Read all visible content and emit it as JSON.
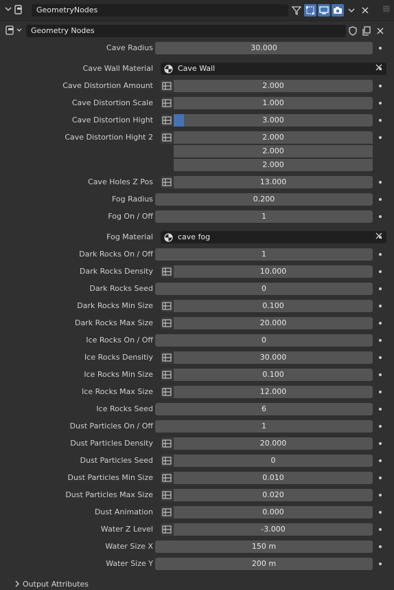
{
  "header": {
    "modifier_name": "GeometryNodes",
    "node_group_name": "Geometry Nodes"
  },
  "inputs": [
    {
      "label": "Cave Radius",
      "value": "30.000"
    },
    {
      "label": "Cave Wall Material",
      "value": "Cave Wall"
    },
    {
      "label": "Cave Distortion Amount",
      "value": "2.000"
    },
    {
      "label": "Cave Distortion Scale",
      "value": "1.000"
    },
    {
      "label": "Cave Distortion Hight",
      "value": "3.000",
      "fill": 0.05
    },
    {
      "label": "Cave Distortion Hight 2",
      "values": [
        "2.000",
        "2.000",
        "2.000"
      ]
    },
    {
      "label": "Cave Holes Z Pos",
      "value": "13.000"
    },
    {
      "label": "Fog Radius",
      "value": "0.200"
    },
    {
      "label": "Fog On / Off",
      "value": "1"
    },
    {
      "label": "Fog Material",
      "value": "cave fog"
    },
    {
      "label": "Dark Rocks On / Off",
      "value": "1"
    },
    {
      "label": "Dark Rocks Density",
      "value": "10.000"
    },
    {
      "label": "Dark Rocks Seed",
      "value": "0"
    },
    {
      "label": "Dark Rocks Min Size",
      "value": "0.100"
    },
    {
      "label": "Dark Rocks Max Size",
      "value": "20.000"
    },
    {
      "label": "Ice Rocks On / Off",
      "value": "0"
    },
    {
      "label": "Ice Rocks Densitiy",
      "value": "30.000"
    },
    {
      "label": "Ice Rocks Min Size",
      "value": "0.100"
    },
    {
      "label": "Ice Rocks Max Size",
      "value": "12.000"
    },
    {
      "label": "Ice Rocks Seed",
      "value": "6"
    },
    {
      "label": "Dust Particles On / Off",
      "value": "1"
    },
    {
      "label": "Dust Particles Density",
      "value": "20.000"
    },
    {
      "label": "Dust Particles Seed",
      "value": "0"
    },
    {
      "label": "Dust Particles Min Size",
      "value": "0.010"
    },
    {
      "label": "Dust Particles Max Size",
      "value": "0.020"
    },
    {
      "label": "Dust Animation",
      "value": "0.000"
    },
    {
      "label": "Water Z Level",
      "value": "-3.000"
    },
    {
      "label": "Water Size X",
      "value": "150 m"
    },
    {
      "label": "Water Size Y",
      "value": "200 m"
    }
  ],
  "footer": {
    "output_attributes_label": "Output Attributes"
  },
  "colors": {
    "accent": "#4772b3",
    "field": "#545454",
    "panel": "#303030"
  }
}
